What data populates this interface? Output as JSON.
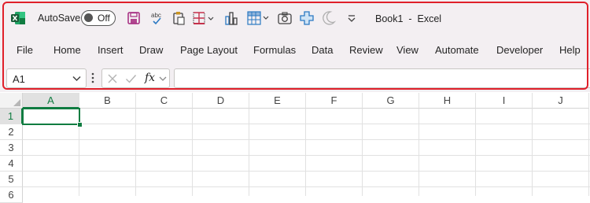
{
  "title_bar": {
    "autosave_label": "AutoSave",
    "autosave_state": "Off",
    "document_title": "Book1  -  Excel"
  },
  "quick_access": [
    "save-icon",
    "spelling-icon",
    "clipboard-icon",
    "borders-icon",
    "chart-icon",
    "table-icon",
    "camera-icon",
    "add-icon",
    "dark-mode-icon",
    "customize-icon"
  ],
  "ribbon": {
    "tabs": [
      "File",
      "Home",
      "Insert",
      "Draw",
      "Page Layout",
      "Formulas",
      "Data",
      "Review",
      "View",
      "Automate",
      "Developer",
      "Help"
    ]
  },
  "formula_bar": {
    "name_box_value": "A1",
    "fx_label": "fx",
    "formula_value": ""
  },
  "sheet": {
    "columns": [
      "A",
      "B",
      "C",
      "D",
      "E",
      "F",
      "G",
      "H",
      "I",
      "J"
    ],
    "rows": [
      "1",
      "2",
      "3",
      "4",
      "5",
      "6"
    ],
    "active_cell": "A1"
  },
  "colors": {
    "excel_green": "#107c41",
    "highlight_red": "#e0202a",
    "ribbon_background": "#f3eff2",
    "accent_purple": "#a4297f",
    "accent_blue": "#2b79c2"
  }
}
